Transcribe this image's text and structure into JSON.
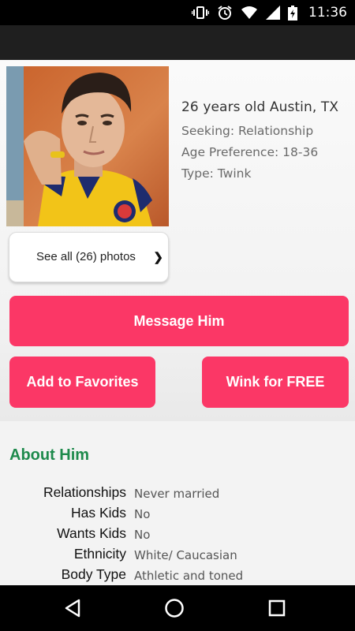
{
  "status_bar": {
    "time": "11:36",
    "icons": [
      "vibrate-icon",
      "alarm-icon",
      "wifi-icon",
      "signal-icon",
      "battery-icon"
    ]
  },
  "profile": {
    "headline": "26 years old Austin, TX",
    "seeking": "Seeking: Relationship",
    "age_preference": "Age Preference: 18-36",
    "type": "Type: Twink",
    "photos_label": "See all (26) photos",
    "photos_chevron": "❯"
  },
  "actions": {
    "message": "Message Him",
    "favorites": "Add to Favorites",
    "wink": "Wink for FREE",
    "accent_color": "#fb3766"
  },
  "about": {
    "title": "About Him",
    "title_color": "#1e8a4c",
    "details": [
      {
        "label": "Relationships",
        "value": "Never married"
      },
      {
        "label": "Has Kids",
        "value": "No"
      },
      {
        "label": "Wants Kids",
        "value": "No"
      },
      {
        "label": "Ethnicity",
        "value": "White/ Caucasian"
      },
      {
        "label": "Body Type",
        "value": "Athletic and toned"
      }
    ]
  },
  "nav_bar": {
    "icons": [
      "back-icon",
      "home-icon",
      "recents-icon"
    ]
  }
}
